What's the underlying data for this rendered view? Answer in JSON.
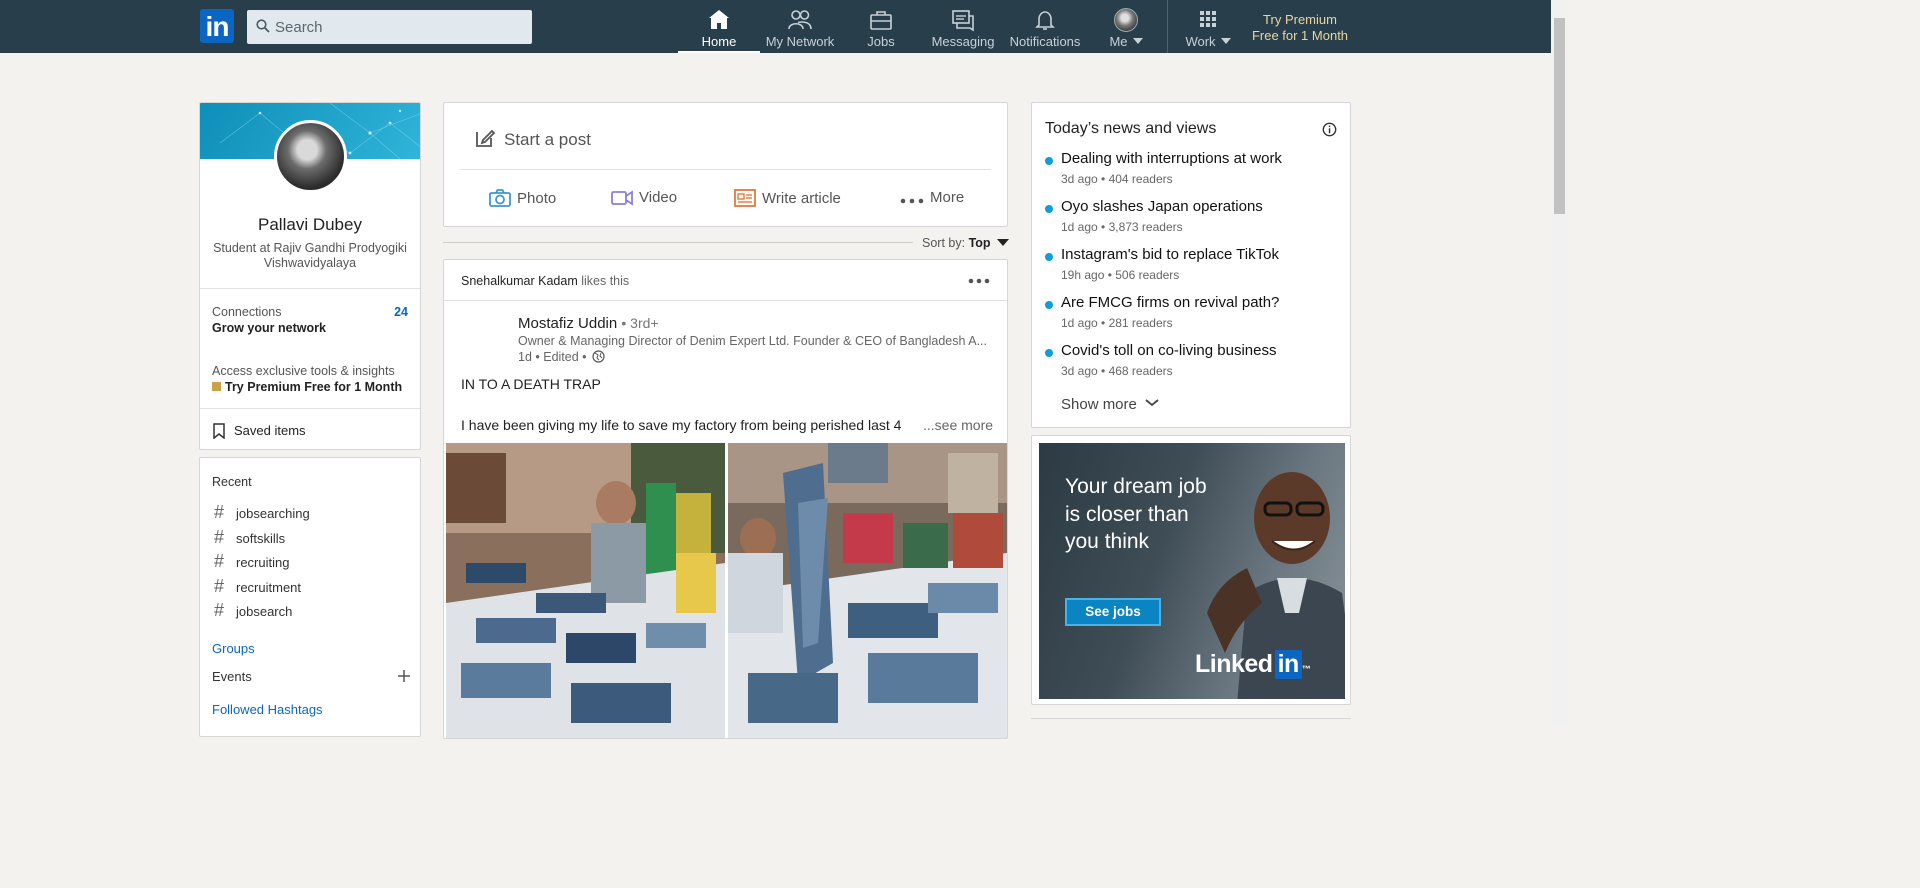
{
  "nav": {
    "logo": "in",
    "search_placeholder": "Search",
    "items": [
      {
        "label": "Home",
        "icon": "home-icon",
        "active": true
      },
      {
        "label": "My Network",
        "icon": "network-icon"
      },
      {
        "label": "Jobs",
        "icon": "briefcase-icon"
      },
      {
        "label": "Messaging",
        "icon": "messaging-icon"
      },
      {
        "label": "Notifications",
        "icon": "bell-icon"
      },
      {
        "label": "Me",
        "icon": "avatar"
      },
      {
        "label": "Work",
        "icon": "grid-icon"
      }
    ],
    "premium": "Try Premium Free for 1 Month"
  },
  "profile": {
    "name": "Pallavi Dubey",
    "headline": "Student at Rajiv Gandhi Prodyogiki Vishwavidyalaya",
    "connections_label": "Connections",
    "connections_count": "24",
    "grow": "Grow your network",
    "access": "Access exclusive tools & insights",
    "premium": "Try Premium Free for 1 Month",
    "saved": "Saved items"
  },
  "recent": {
    "title": "Recent",
    "tags": [
      "jobsearching",
      "softskills",
      "recruiting",
      "recruitment",
      "jobsearch"
    ],
    "groups": "Groups",
    "events": "Events",
    "followed": "Followed Hashtags"
  },
  "share": {
    "start": "Start a post",
    "photo": "Photo",
    "video": "Video",
    "article": "Write article",
    "more": "More"
  },
  "sort": {
    "label": "Sort by:",
    "value": "Top"
  },
  "post": {
    "liker": "Snehalkumar Kadam",
    "likes_text": "likes this",
    "author": "Mostafiz Uddin",
    "degree": "• 3rd+",
    "author_headline": "Owner & Managing Director of Denim Expert Ltd. Founder & CEO of Bangladesh A...",
    "time": "1d • Edited •",
    "title": "IN TO A DEATH TRAP",
    "body": "I have been giving my life to save my factory from being perished last 4",
    "see_more": "...see more"
  },
  "news": {
    "title": "Today’s news and views",
    "items": [
      {
        "title": "Dealing with interruptions at work",
        "meta": "3d ago • 404 readers"
      },
      {
        "title": "Oyo slashes Japan operations",
        "meta": "1d ago • 3,873 readers"
      },
      {
        "title": "Instagram's bid to replace TikTok",
        "meta": "19h ago • 506 readers"
      },
      {
        "title": "Are FMCG firms on revival path?",
        "meta": "1d ago • 281 readers"
      },
      {
        "title": "Covid's toll on co-living business",
        "meta": "3d ago • 468 readers"
      }
    ],
    "show_more": "Show more"
  },
  "ad": {
    "text": "Your dream job is closer than you think",
    "button": "See jobs",
    "logo_text": "Linked",
    "logo_in": "in",
    "logo_tm": "™"
  },
  "colors": {
    "nav_bg": "#283e4a",
    "brand": "#0a66c2",
    "accent_link": "#0a66c2",
    "premium_gold": "#e9d69e",
    "news_dot": "#0a9fd8"
  }
}
